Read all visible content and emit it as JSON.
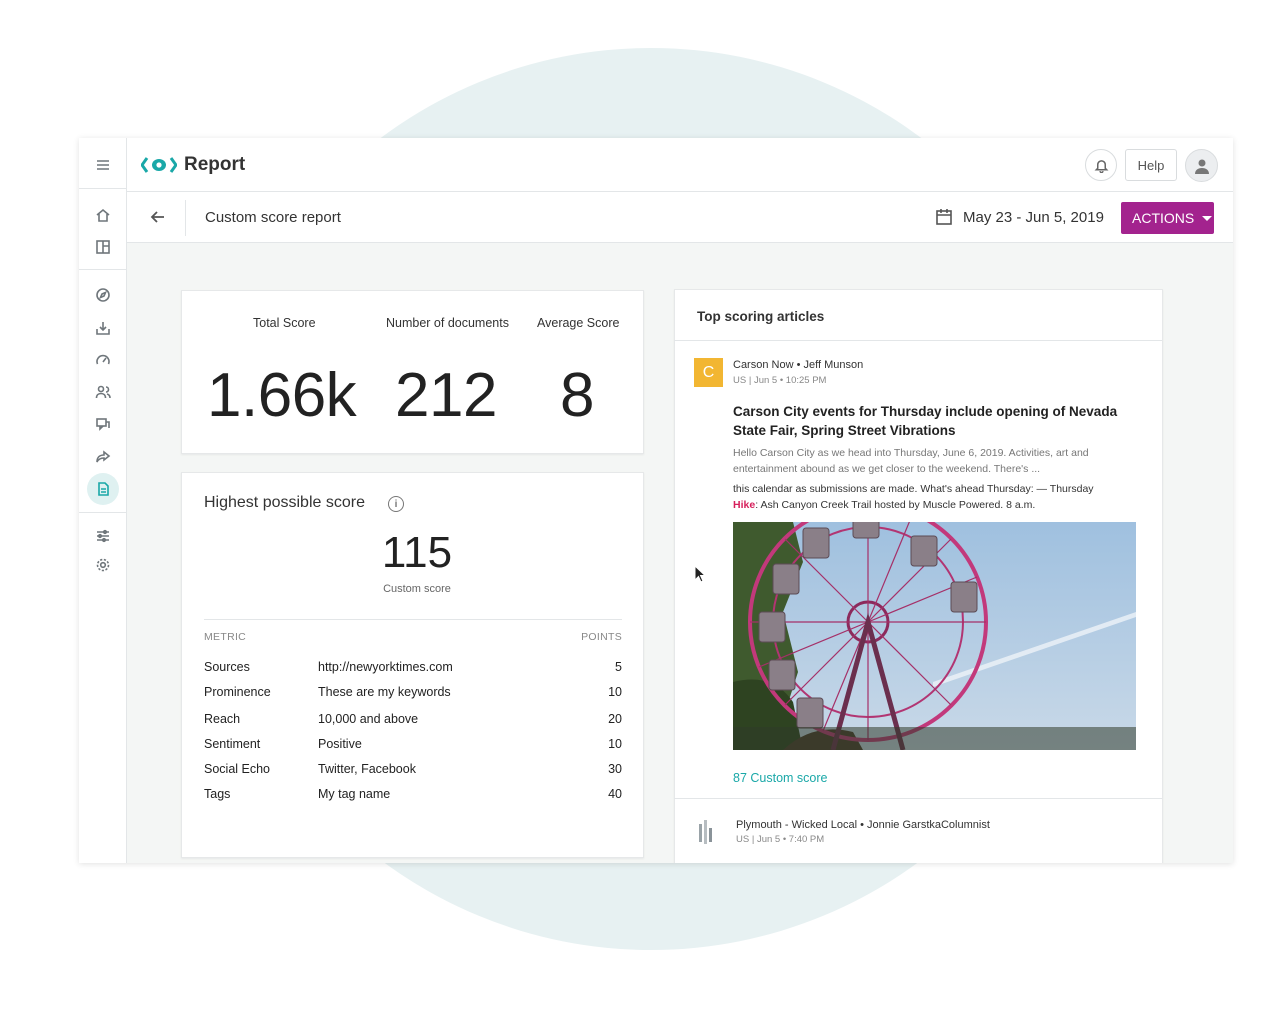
{
  "app": {
    "title": "Report"
  },
  "header": {
    "help_label": "Help"
  },
  "subheader": {
    "report_title": "Custom score report",
    "date_range": "May 23 - Jun 5, 2019",
    "actions_label": "ACTIONS"
  },
  "stats": [
    {
      "label": "Total Score",
      "value": "1.66k"
    },
    {
      "label": "Number of documents",
      "value": "212"
    },
    {
      "label": "Average Score",
      "value": "8"
    }
  ],
  "highest": {
    "title": "Highest possible score",
    "score": "115",
    "score_label": "Custom score",
    "metric_header": "METRIC",
    "points_header": "POINTS",
    "rows": [
      {
        "metric": "Sources",
        "value": "http://newyorktimes.com",
        "points": "5"
      },
      {
        "metric": "Prominence",
        "value": "These are my keywords",
        "points": "10"
      },
      {
        "metric": "Reach",
        "value": "10,000 and above",
        "points": "20"
      },
      {
        "metric": "Sentiment",
        "value": "Positive",
        "points": "10"
      },
      {
        "metric": "Social Echo",
        "value": "Twitter, Facebook",
        "points": "30"
      },
      {
        "metric": "Tags",
        "value": "My tag name",
        "points": "40"
      }
    ]
  },
  "articles": {
    "heading": "Top scoring articles",
    "first": {
      "badge": "C",
      "source": "Carson Now • Jeff Munson",
      "meta": "US | Jun 5 • 10:25 PM",
      "title": "Carson City events for Thursday include opening of Nevada State Fair, Spring Street Vibrations",
      "snippet1": "Hello Carson City as we head into Thursday, June 6, 2019. Activities, art and entertainment abound as we get closer to the weekend. There's ...",
      "snippet2_pre": "this calendar as submissions are made. What's ahead Thursday: — Thursday",
      "snippet2_hl": "Hike",
      "snippet2_post": ": Ash Canyon Creek Trail hosted by Muscle Powered. 8 a.m.",
      "score": "87 Custom score"
    },
    "second": {
      "source": "Plymouth - Wicked Local • Jonnie GarstkaColumnist",
      "meta": "US | Jun 5 • 7:40 PM"
    }
  },
  "colors": {
    "accent": "#1aa8a8",
    "actions": "#a3238e",
    "highlight": "#d61f5b",
    "badge": "#f2b632"
  },
  "icons": [
    "menu-icon",
    "home-icon",
    "dashboard-icon",
    "explore-icon",
    "inbox-icon",
    "gauge-icon",
    "people-icon",
    "chat-icon",
    "share-icon",
    "report-icon",
    "sliders-icon",
    "gear-icon",
    "bell-icon",
    "user-icon",
    "back-arrow-icon",
    "calendar-icon",
    "info-icon"
  ]
}
